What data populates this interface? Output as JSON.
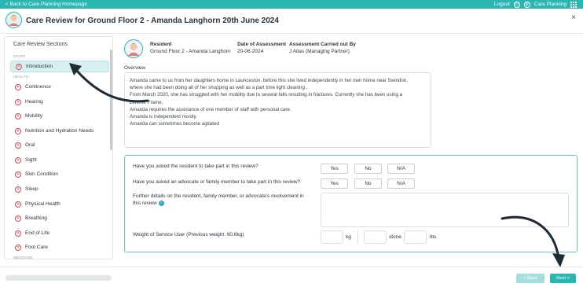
{
  "topbar": {
    "back_label": "< Back to Care Planning Homepage",
    "logout_label": "Logout",
    "app_label": "Care Planning"
  },
  "header": {
    "title": "Care Review for Ground Floor 2 - Amanda Langhorn 20th June 2024",
    "close_glyph": "×"
  },
  "sidebar": {
    "title": "Care Review Sections",
    "groups": [
      "START",
      "HEALTH",
      "MEDICINE"
    ],
    "items": [
      {
        "label": "Introduction",
        "status": "incomplete",
        "active": true
      },
      {
        "label": "Continence",
        "status": "incomplete"
      },
      {
        "label": "Hearing",
        "status": "incomplete"
      },
      {
        "label": "Mobility",
        "status": "incomplete"
      },
      {
        "label": "Nutrition and Hydration Needs",
        "status": "incomplete"
      },
      {
        "label": "Oral",
        "status": "incomplete"
      },
      {
        "label": "Sight",
        "status": "incomplete"
      },
      {
        "label": "Skin Condition",
        "status": "incomplete"
      },
      {
        "label": "Sleep",
        "status": "incomplete"
      },
      {
        "label": "Physical Health",
        "status": "incomplete"
      },
      {
        "label": "Breathing",
        "status": "incomplete"
      },
      {
        "label": "End of Life",
        "status": "incomplete"
      },
      {
        "label": "Foot Care",
        "status": "incomplete"
      }
    ]
  },
  "resident": {
    "resident_label": "Resident",
    "resident_value": "Ground Floor 2 - Amanda Langhorn",
    "date_label": "Date of Assessment",
    "date_value": "20-06-2024",
    "assessor_label": "Assessment Carried out By",
    "assessor_value": "J Atlas (Managing Partner)"
  },
  "overview": {
    "label": "Overview",
    "lines": [
      "Amanda came to us from her daughters home in Launceston, before this she lived independently in her own home near Swindon,",
      "where she had been doing all of her shopping as well as a part time light cleaning .",
      "From March 2020, she has struggled with her mobility due to several falls resulting in fractures. Currently she has been using a",
      "Zimmer Frame,",
      "Amanda requires the assistance of one member of staff with personal care.",
      "Amanda is independent mostly.",
      "Amanda can sometimes become agitated"
    ]
  },
  "questions": {
    "q1": "Have you asked the resident to take part in this review?",
    "q2": "Have you asked an advocate or family member to take part in this review?",
    "q3_line1": "Further details on the resident, family member, or advocate's involvement in",
    "q3_line2": "this review",
    "options": [
      "Yes",
      "No",
      "N/A"
    ],
    "weight_label": "Weight of Service User (Previous weight: 60.6kg)",
    "units": {
      "kg": "kg",
      "stone": "stone",
      "lbs": "lbs"
    }
  },
  "footer": {
    "back_label": "< Back",
    "next_label": "Next >"
  },
  "colors": {
    "accent": "#2bb6b2",
    "error": "#d9454d",
    "active_bg": "#d6f0ef"
  }
}
